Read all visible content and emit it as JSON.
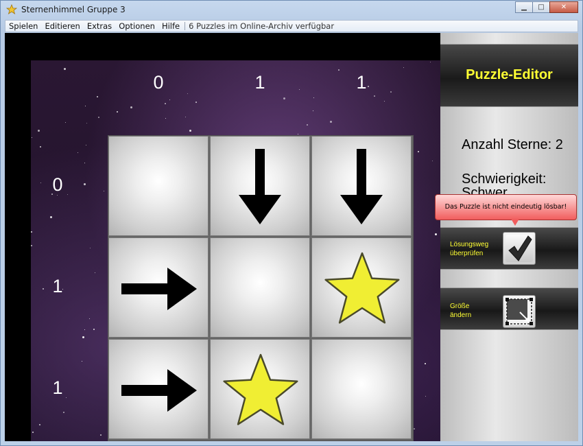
{
  "window": {
    "title": "Sternenhimmel Gruppe 3",
    "controls": {
      "minimize": "▁",
      "maximize": "□",
      "close": "✕"
    }
  },
  "menubar": {
    "items": [
      "Spielen",
      "Editieren",
      "Extras",
      "Optionen",
      "Hilfe"
    ],
    "status": "6 Puzzles im Online-Archiv verfügbar"
  },
  "puzzle": {
    "column_hints": [
      "0",
      "1",
      "1"
    ],
    "row_hints": [
      "0",
      "1",
      "1"
    ],
    "cells": [
      [
        "empty",
        "arrow-down",
        "arrow-down"
      ],
      [
        "arrow-right",
        "empty",
        "star"
      ],
      [
        "arrow-right",
        "star",
        "empty"
      ]
    ]
  },
  "panel": {
    "title": "Puzzle-Editor",
    "star_count": "Anzahl Sterne: 2",
    "difficulty_label": "Schwierigkeit:",
    "difficulty_value": "Schwer",
    "tooltip": "Das Puzzle ist nicht eindeutig lösbar!",
    "check_label_1": "Lösungsweg",
    "check_label_2": "überprüfen",
    "resize_label_1": "Größe",
    "resize_label_2": "ändern"
  },
  "colors": {
    "accent_text": "#ffff33",
    "tooltip_bg": "#f15d5d",
    "star_fill": "#f0ee33"
  }
}
